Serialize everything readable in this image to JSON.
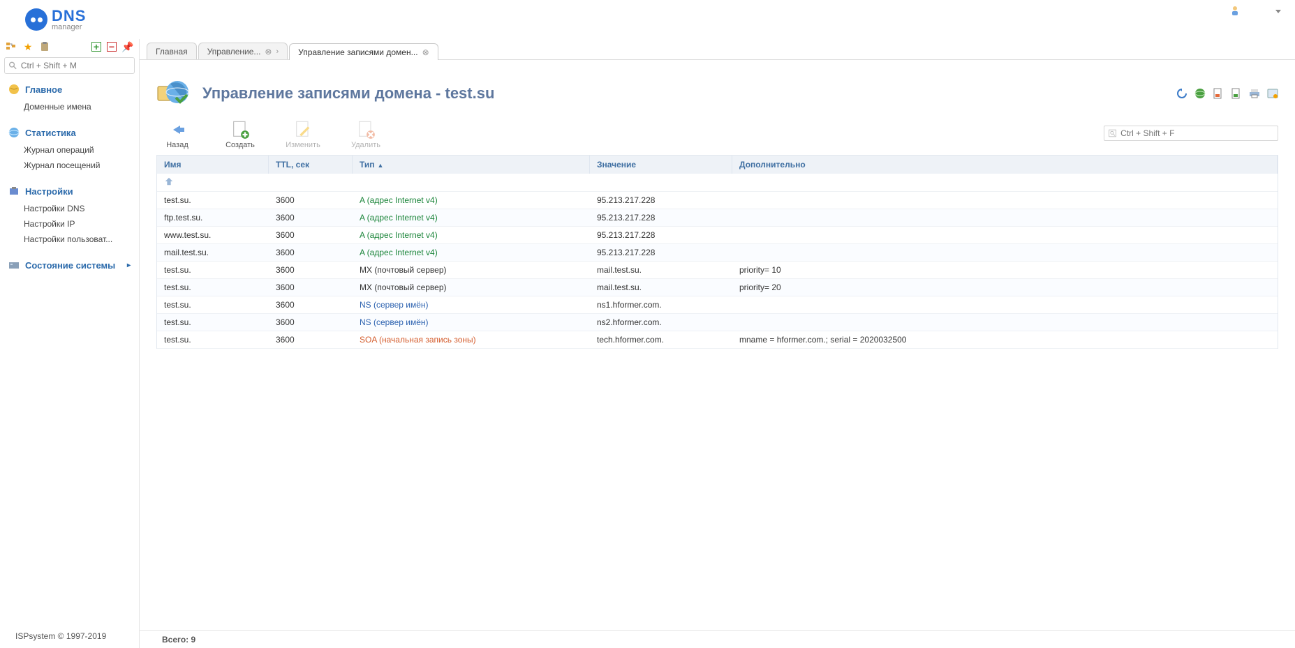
{
  "logo": {
    "dns": "DNS",
    "manager": "manager"
  },
  "sidebar": {
    "search_placeholder": "Ctrl + Shift + M",
    "groups": [
      {
        "title": "Главное",
        "expanded": true,
        "items": [
          {
            "label": "Доменные имена"
          }
        ]
      },
      {
        "title": "Статистика",
        "expanded": true,
        "items": [
          {
            "label": "Журнал операций"
          },
          {
            "label": "Журнал посещений"
          }
        ]
      },
      {
        "title": "Настройки",
        "expanded": true,
        "items": [
          {
            "label": "Настройки DNS"
          },
          {
            "label": "Настройки IP"
          },
          {
            "label": "Настройки пользоват..."
          }
        ]
      },
      {
        "title": "Состояние системы",
        "expanded": false,
        "items": []
      }
    ],
    "footer": "ISPsystem © 1997-2019"
  },
  "tabs": [
    {
      "label": "Главная",
      "closable": false,
      "active": false
    },
    {
      "label": "Управление...",
      "closable": true,
      "active": false,
      "chevron": true
    },
    {
      "label": "Управление записями домен...",
      "closable": true,
      "active": true
    }
  ],
  "page": {
    "title": "Управление записями домена - test.su",
    "actions": {
      "back": "Назад",
      "create": "Создать",
      "edit": "Изменить",
      "delete": "Удалить"
    },
    "search_placeholder": "Ctrl + Shift + F"
  },
  "columns": {
    "name": "Имя",
    "ttl": "TTL, сек",
    "type": "Тип",
    "value": "Значение",
    "extra": "Дополнительно"
  },
  "rows": [
    {
      "name": "test.su.",
      "ttl": "3600",
      "type": "A (адрес Internet v4)",
      "typecls": "type-a",
      "value": "95.213.217.228",
      "extra": ""
    },
    {
      "name": "ftp.test.su.",
      "ttl": "3600",
      "type": "A (адрес Internet v4)",
      "typecls": "type-a",
      "value": "95.213.217.228",
      "extra": ""
    },
    {
      "name": "www.test.su.",
      "ttl": "3600",
      "type": "A (адрес Internet v4)",
      "typecls": "type-a",
      "value": "95.213.217.228",
      "extra": ""
    },
    {
      "name": "mail.test.su.",
      "ttl": "3600",
      "type": "A (адрес Internet v4)",
      "typecls": "type-a",
      "value": "95.213.217.228",
      "extra": ""
    },
    {
      "name": "test.su.",
      "ttl": "3600",
      "type": "MX (почтовый сервер)",
      "typecls": "",
      "value": "mail.test.su.",
      "extra": "priority= 10"
    },
    {
      "name": "test.su.",
      "ttl": "3600",
      "type": "MX (почтовый сервер)",
      "typecls": "",
      "value": "mail.test.su.",
      "extra": "priority= 20"
    },
    {
      "name": "test.su.",
      "ttl": "3600",
      "type": "NS (сервер имён)",
      "typecls": "type-ns",
      "value": "ns1.hformer.com.",
      "extra": ""
    },
    {
      "name": "test.su.",
      "ttl": "3600",
      "type": "NS (сервер имён)",
      "typecls": "type-ns",
      "value": "ns2.hformer.com.",
      "extra": ""
    },
    {
      "name": "test.su.",
      "ttl": "3600",
      "type": "SOA (начальная запись зоны)",
      "typecls": "type-soa",
      "value": "tech.hformer.com.",
      "extra": "mname = hformer.com.; serial = 2020032500"
    }
  ],
  "status": "Всего: 9"
}
